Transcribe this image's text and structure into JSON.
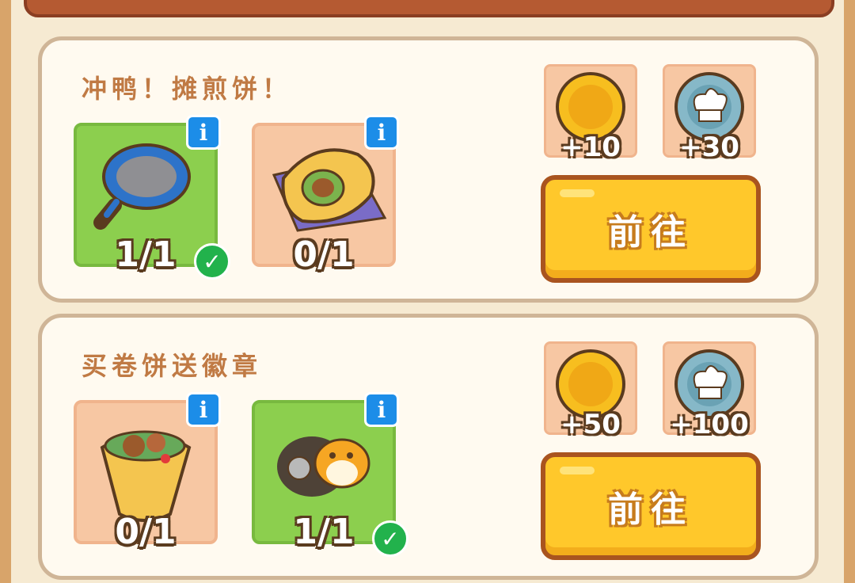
{
  "tasks": [
    {
      "title": "冲鸭！摊煎饼！",
      "items": [
        {
          "name": "frying-pan",
          "count": "1/1",
          "completed": true
        },
        {
          "name": "pancake-roll",
          "count": "0/1",
          "completed": false
        }
      ],
      "rewards": [
        {
          "type": "gold-coin",
          "amount": "+10"
        },
        {
          "type": "chef-coin",
          "amount": "+30"
        }
      ],
      "button": "前往"
    },
    {
      "title": "买卷饼送徽章",
      "items": [
        {
          "name": "wrap",
          "count": "0/1",
          "completed": false
        },
        {
          "name": "badge-character",
          "count": "1/1",
          "completed": true
        }
      ],
      "rewards": [
        {
          "type": "gold-coin",
          "amount": "+50"
        },
        {
          "type": "chef-coin",
          "amount": "+100"
        }
      ],
      "button": "前往"
    }
  ],
  "colors": {
    "accent": "#ffc82b",
    "complete": "#22b24c",
    "info": "#1c8de8",
    "title": "#c07a44"
  }
}
